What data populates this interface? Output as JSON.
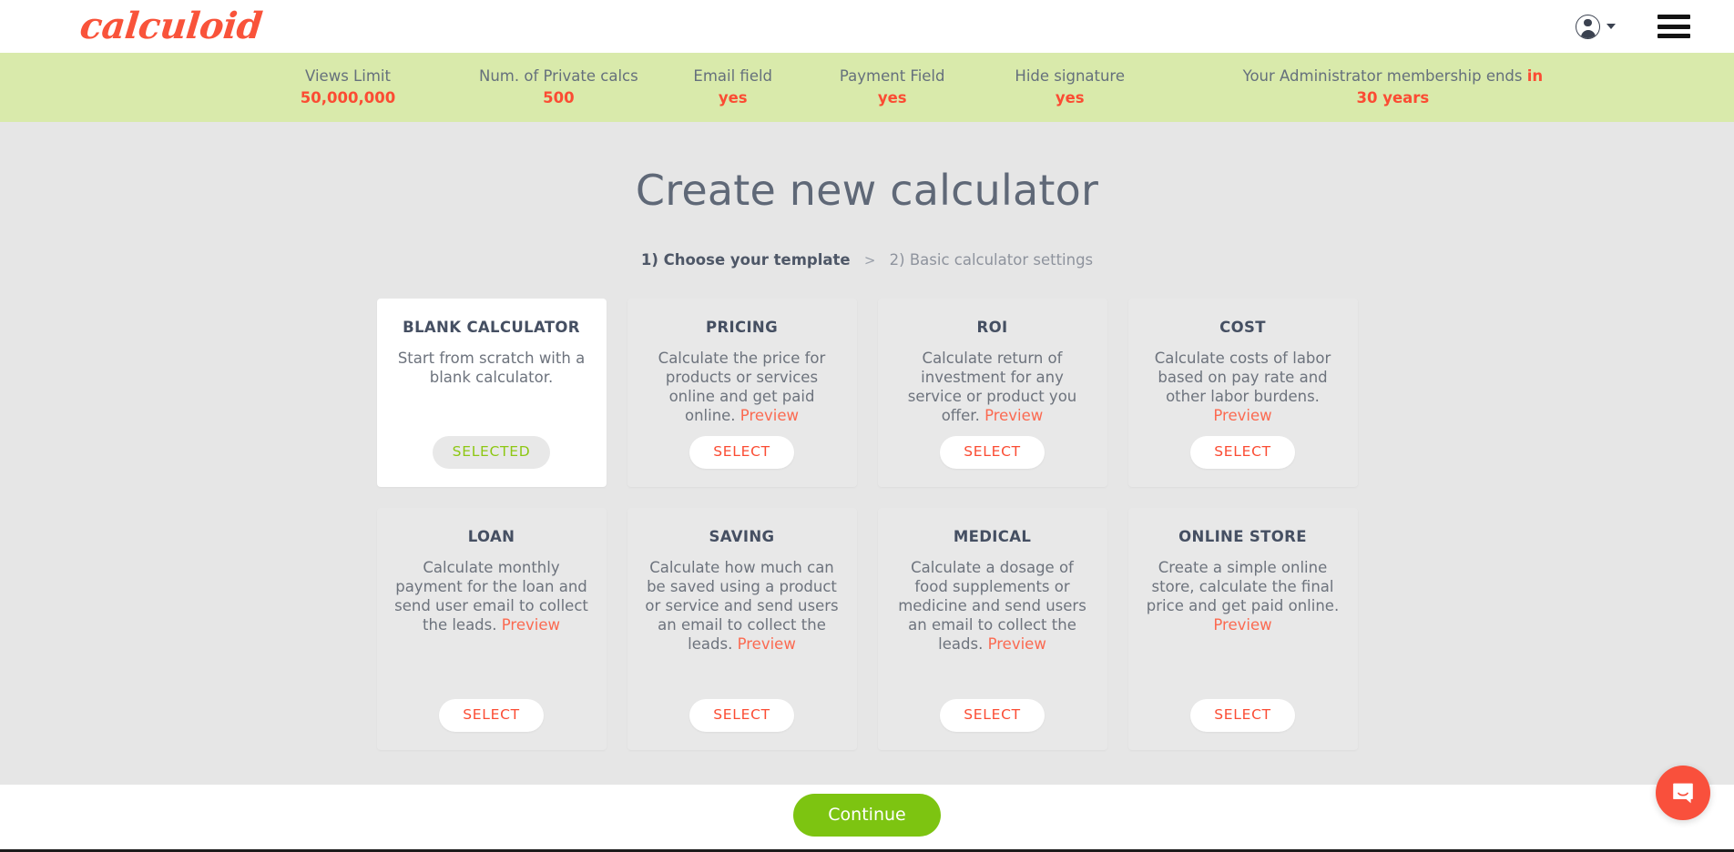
{
  "header": {
    "logo_text": "calculoid",
    "user_menu_icon": "user-avatar-icon",
    "caret_icon": "chevron-down-icon",
    "menu_icon": "hamburger-menu-icon"
  },
  "status_bar": {
    "background_color": "#d9eaab",
    "value_color": "#fb4c33",
    "items": [
      {
        "label": "Views Limit",
        "value": "50,000,000"
      },
      {
        "label": "Num. of Private calcs",
        "value": "500"
      },
      {
        "label": "Email field",
        "value": "yes"
      },
      {
        "label": "Payment Field",
        "value": "yes"
      },
      {
        "label": "Hide signature",
        "value": "yes"
      }
    ],
    "membership": {
      "label_plain": "Your Administrator membership ends ",
      "label_highlight": "in",
      "value": "30 years"
    }
  },
  "main": {
    "title": "Create new calculator",
    "breadcrumb": {
      "current": "1) Choose your template",
      "separator": ">",
      "next": "2) Basic calculator settings"
    },
    "cards": [
      {
        "title": "BLANK CALCULATOR",
        "desc": "Start from scratch with a blank calculator.",
        "preview_label": "",
        "button_label": "SELECTED",
        "selected": true
      },
      {
        "title": "PRICING",
        "desc": "Calculate the price for products or services online and get paid online. ",
        "preview_label": "Preview",
        "button_label": "SELECT",
        "selected": false
      },
      {
        "title": "ROI",
        "desc": "Calculate return of investment for any service or product you offer. ",
        "preview_label": "Preview",
        "button_label": "SELECT",
        "selected": false
      },
      {
        "title": "COST",
        "desc": "Calculate costs of labor based on pay rate and other labor burdens. ",
        "preview_label": "Preview",
        "button_label": "SELECT",
        "selected": false
      },
      {
        "title": "LOAN",
        "desc": "Calculate monthly payment for the loan and send user email to collect the leads. ",
        "preview_label": "Preview",
        "button_label": "SELECT",
        "selected": false
      },
      {
        "title": "SAVING",
        "desc": "Calculate how much can be saved using a product or service and send users an email to collect the leads. ",
        "preview_label": "Preview",
        "button_label": "SELECT",
        "selected": false
      },
      {
        "title": "MEDICAL",
        "desc": "Calculate a dosage of food supplements or medicine and send users an email to collect the leads. ",
        "preview_label": "Preview",
        "button_label": "SELECT",
        "selected": false
      },
      {
        "title": "ONLINE STORE",
        "desc": "Create a simple online store, calculate the final price and get paid online. ",
        "preview_label": "Preview",
        "button_label": "SELECT",
        "selected": false
      }
    ]
  },
  "footer": {
    "continue_label": "Continue",
    "continue_color": "#7dc411"
  },
  "chat": {
    "icon": "chat-bubble-icon",
    "color": "#f9503c"
  }
}
